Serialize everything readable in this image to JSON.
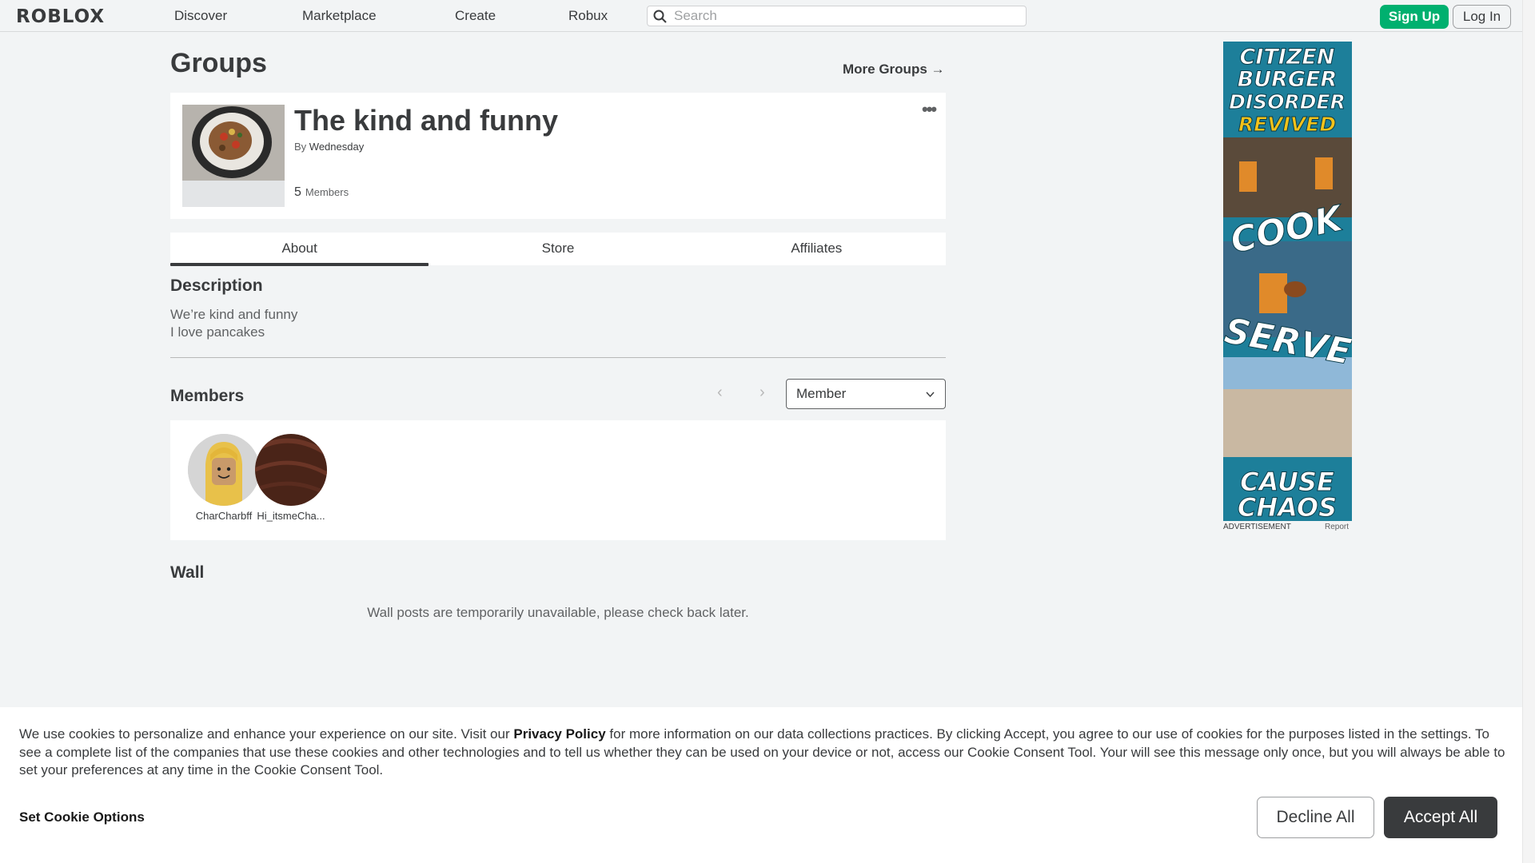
{
  "nav": {
    "logo": "ROBLOX",
    "links": [
      "Discover",
      "Marketplace",
      "Create",
      "Robux"
    ],
    "search_placeholder": "Search",
    "signup": "Sign Up",
    "login": "Log In"
  },
  "page": {
    "title": "Groups",
    "more_groups": "More Groups →"
  },
  "group": {
    "name": "The kind and funny",
    "by_label": "By",
    "owner": "Wednesday",
    "member_count": "5",
    "member_label": "Members",
    "more_icon": "more-dots-icon"
  },
  "tabs": [
    {
      "label": "About",
      "active": true
    },
    {
      "label": "Store",
      "active": false
    },
    {
      "label": "Affiliates",
      "active": false
    }
  ],
  "description": {
    "heading": "Description",
    "lines": [
      "We’re kind and funny",
      "I love pancakes"
    ]
  },
  "members": {
    "heading": "Members",
    "role_selected": "Member",
    "list": [
      {
        "name": "CharCharbff"
      },
      {
        "name": "Hi_itsmeCha..."
      }
    ]
  },
  "wall": {
    "heading": "Wall",
    "message": "Wall posts are temporarily unavailable, please check back later."
  },
  "ad": {
    "caption": "ADVERTISEMENT",
    "report": "Report",
    "lines": [
      "CITIZEN",
      "BURGER",
      "DISORDER",
      "REVIVED",
      "COOK",
      "SERVE",
      "CAUSE",
      "CHAOS"
    ]
  },
  "cookie": {
    "text_before": "We use cookies to personalize and enhance your experience on our site. Visit our ",
    "link": "Privacy Policy",
    "text_after": " for more information on our data collections practices. By clicking Accept, you agree to our use of cookies for the purposes listed in the settings. To see a complete list of the companies that use these cookies and other technologies and to tell us whether they can be used on your device or not, access our Cookie Consent Tool. Your will see this message only once, but you will always be able to set your preferences at any time in the Cookie Consent Tool.",
    "options": "Set Cookie Options",
    "decline": "Decline All",
    "accept": "Accept All"
  },
  "colors": {
    "accent_green": "#00b06f",
    "text": "#393b3d",
    "background": "#f2f4f5"
  }
}
